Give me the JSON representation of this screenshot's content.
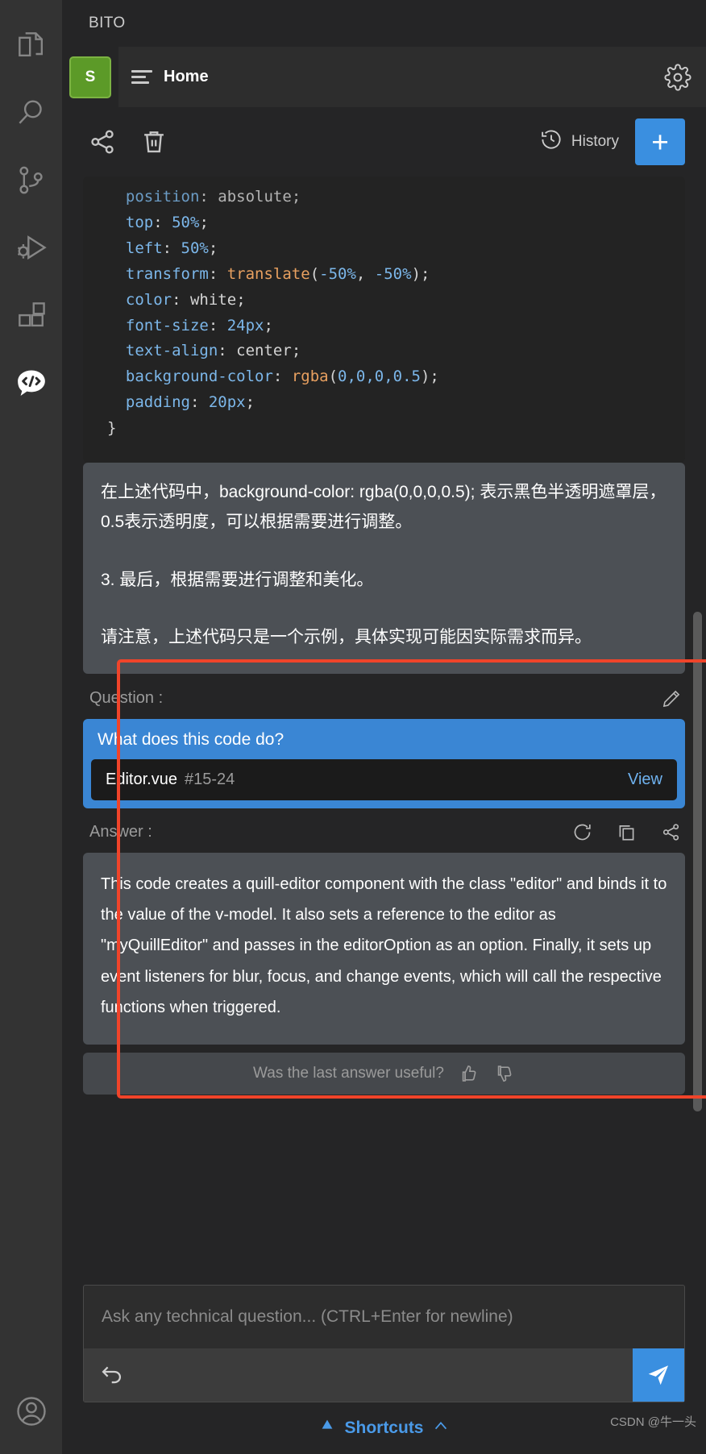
{
  "activity_bar": {
    "items": [
      {
        "name": "explorer-icon",
        "label": "Explorer"
      },
      {
        "name": "search-icon",
        "label": "Search"
      },
      {
        "name": "source-control-icon",
        "label": "Source Control"
      },
      {
        "name": "run-debug-icon",
        "label": "Run and Debug"
      },
      {
        "name": "extensions-icon",
        "label": "Extensions"
      },
      {
        "name": "bito-chat-icon",
        "label": "Bito AI"
      }
    ],
    "account_icon": "account-icon"
  },
  "panel": {
    "title": "BITO",
    "avatar_initial": "S",
    "tab_label": "Home",
    "settings_icon": "gear-icon"
  },
  "toolbar": {
    "share_icon": "share-icon",
    "delete_icon": "trash-icon",
    "history_label": "History",
    "history_icon": "history-icon",
    "new_chat_label": "+"
  },
  "code_block": {
    "language": "css",
    "lines": [
      {
        "indent": 1,
        "tokens": [
          {
            "t": "position",
            "c": "k"
          },
          {
            "t": ": ",
            "c": "p"
          },
          {
            "t": "absolute",
            "c": "v"
          },
          {
            "t": ";",
            "c": "p"
          }
        ],
        "faded": true
      },
      {
        "indent": 1,
        "tokens": [
          {
            "t": "top",
            "c": "k"
          },
          {
            "t": ": ",
            "c": "p"
          },
          {
            "t": "50%",
            "c": "n"
          },
          {
            "t": ";",
            "c": "p"
          }
        ]
      },
      {
        "indent": 1,
        "tokens": [
          {
            "t": "left",
            "c": "k"
          },
          {
            "t": ": ",
            "c": "p"
          },
          {
            "t": "50%",
            "c": "n"
          },
          {
            "t": ";",
            "c": "p"
          }
        ]
      },
      {
        "indent": 1,
        "tokens": [
          {
            "t": "transform",
            "c": "k"
          },
          {
            "t": ": ",
            "c": "p"
          },
          {
            "t": "translate",
            "c": "fn"
          },
          {
            "t": "(",
            "c": "p"
          },
          {
            "t": "-50%",
            "c": "n"
          },
          {
            "t": ", ",
            "c": "p"
          },
          {
            "t": "-50%",
            "c": "n"
          },
          {
            "t": ");",
            "c": "p"
          }
        ]
      },
      {
        "indent": 1,
        "tokens": [
          {
            "t": "color",
            "c": "k"
          },
          {
            "t": ": ",
            "c": "p"
          },
          {
            "t": "white",
            "c": "v"
          },
          {
            "t": ";",
            "c": "p"
          }
        ]
      },
      {
        "indent": 1,
        "tokens": [
          {
            "t": "font-size",
            "c": "k"
          },
          {
            "t": ": ",
            "c": "p"
          },
          {
            "t": "24px",
            "c": "n"
          },
          {
            "t": ";",
            "c": "p"
          }
        ]
      },
      {
        "indent": 1,
        "tokens": [
          {
            "t": "text-align",
            "c": "k"
          },
          {
            "t": ": ",
            "c": "p"
          },
          {
            "t": "center",
            "c": "v"
          },
          {
            "t": ";",
            "c": "p"
          }
        ]
      },
      {
        "indent": 1,
        "tokens": [
          {
            "t": "background-color",
            "c": "k"
          },
          {
            "t": ": ",
            "c": "p"
          },
          {
            "t": "rgba",
            "c": "fn"
          },
          {
            "t": "(",
            "c": "p"
          },
          {
            "t": "0,0,0,0.5",
            "c": "n"
          },
          {
            "t": ");",
            "c": "p"
          }
        ]
      },
      {
        "indent": 1,
        "tokens": [
          {
            "t": "padding",
            "c": "k"
          },
          {
            "t": ": ",
            "c": "p"
          },
          {
            "t": "20px",
            "c": "n"
          },
          {
            "t": ";",
            "c": "p"
          }
        ]
      },
      {
        "indent": 0,
        "tokens": [
          {
            "t": "}",
            "c": "p"
          }
        ]
      }
    ]
  },
  "prose": {
    "paragraphs": [
      "在上述代码中，background-color: rgba(0,0,0,0.5); 表示黑色半透明遮罩层，0.5表示透明度，可以根据需要进行调整。",
      "3. 最后，根据需要进行调整和美化。",
      "请注意，上述代码只是一个示例，具体实现可能因实际需求而异。"
    ]
  },
  "qa": {
    "question_label": "Question :",
    "edit_icon": "pencil-icon",
    "question_text": "What does this code do?",
    "file_name": "Editor.vue",
    "file_range": "#15-24",
    "view_label": "View",
    "answer_label": "Answer :",
    "regenerate_icon": "refresh-icon",
    "copy_icon": "copy-icon",
    "share_icon": "share-icon",
    "answer_text": "This code creates a quill-editor component with the class \"editor\" and binds it to the value of the v-model. It also sets a reference to the editor as \"myQuillEditor\" and passes in the editorOption as an option. Finally, it sets up event listeners for blur, focus, and change events, which will call the respective functions when triggered.",
    "feedback_label": "Was the last answer useful?",
    "thumbs_up_icon": "thumbs-up-icon",
    "thumbs_down_icon": "thumbs-down-icon"
  },
  "composer": {
    "placeholder": "Ask any technical question... (CTRL+Enter for newline)",
    "value": "",
    "undo_icon": "undo-icon",
    "send_icon": "send-icon"
  },
  "footer": {
    "shortcuts_label": "Shortcuts",
    "shortcuts_icon": "bito-logo-icon",
    "chevron_icon": "chevron-up-icon",
    "credit": "CSDN @牛一头"
  },
  "colors": {
    "accent_blue": "#3a8fe0",
    "highlight_red": "#f0442a",
    "avatar_green": "#5c9a28",
    "panel_bg": "#252526",
    "bubble_bg": "#4c5055"
  }
}
